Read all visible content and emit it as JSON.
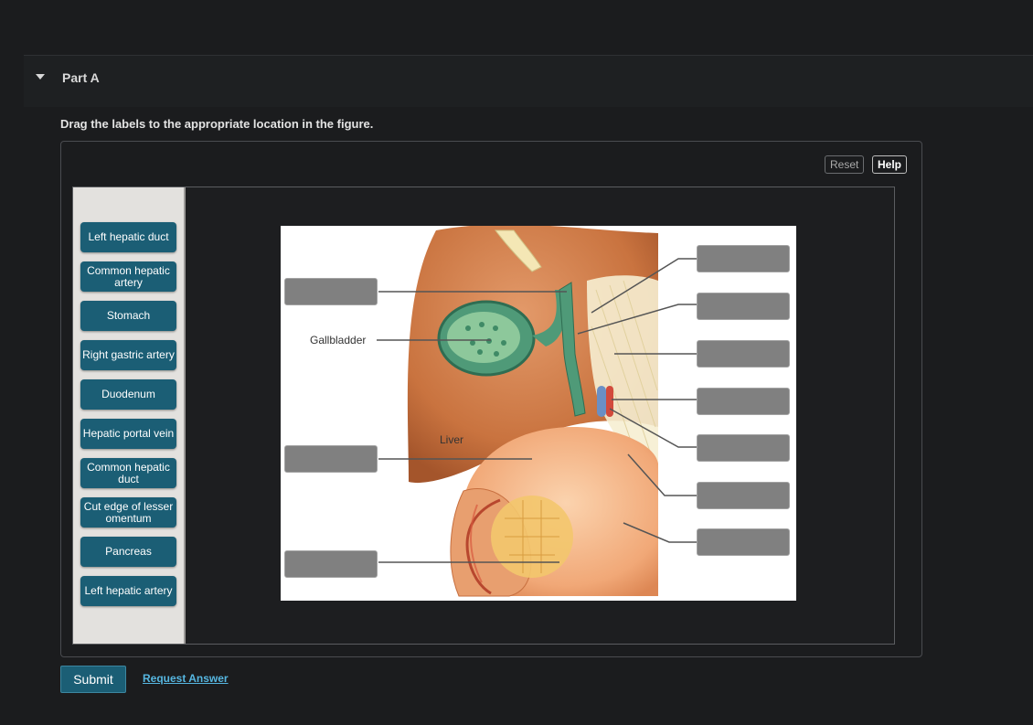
{
  "part": {
    "title": "Part A"
  },
  "instruction": "Drag the labels to the appropriate location in the figure.",
  "toolbar": {
    "reset_label": "Reset",
    "help_label": "Help"
  },
  "labels": [
    "Left hepatic duct",
    "Common hepatic artery",
    "Stomach",
    "Right gastric artery",
    "Duodenum",
    "Hepatic portal vein",
    "Common hepatic duct",
    "Cut edge of lesser omentum",
    "Pancreas",
    "Left hepatic artery"
  ],
  "figure": {
    "gallbladder_label": "Gallbladder",
    "liver_label": "Liver"
  },
  "actions": {
    "submit_label": "Submit",
    "request_label": "Request Answer"
  }
}
